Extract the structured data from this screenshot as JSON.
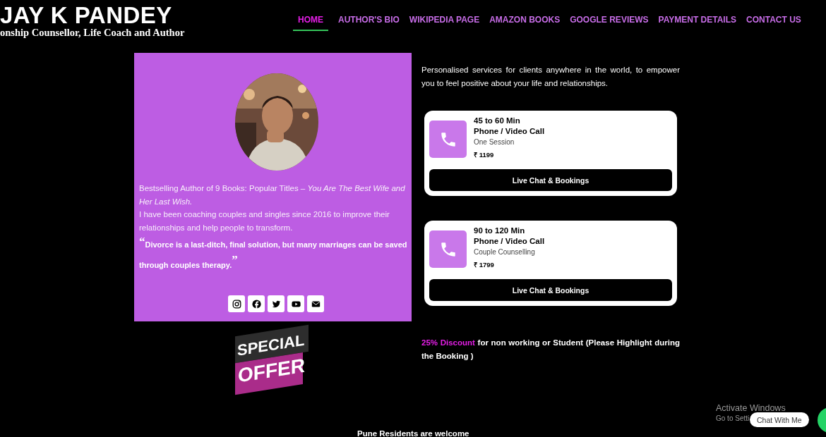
{
  "header": {
    "logo_title": "JAY K PANDEY",
    "logo_subtitle": "onship Counsellor, Life Coach and Author"
  },
  "nav": [
    {
      "label": "HOME",
      "selected": true
    },
    {
      "label": "AUTHOR'S BIO",
      "selected": false
    },
    {
      "label": "WIKIPEDIA PAGE",
      "selected": false
    },
    {
      "label": "AMAZON BOOKS",
      "selected": false
    },
    {
      "label": "GOOGLE REVIEWS",
      "selected": false
    },
    {
      "label": "PAYMENT DETAILS",
      "selected": false
    },
    {
      "label": "CONTACT US",
      "selected": false
    }
  ],
  "profile": {
    "bio": "Bestselling Author of 9 Books: Popular Titles – *You Are The Best Wife and Her Last Wish.*",
    "coaching": "I have been coaching couples and singles since 2016 to improve their relationships and help people to transform.",
    "quote_open": "“",
    "quote": "Divorce is a last-ditch, final solution, but many marriages can be saved through couples therapy.",
    "quote_close": "”",
    "social": [
      {
        "kind": "instagram"
      },
      {
        "kind": "facebook"
      },
      {
        "kind": "twitter"
      },
      {
        "kind": "youtube"
      },
      {
        "kind": "email"
      }
    ]
  },
  "intro": "Personalised services for clients anywhere in the world, to empower you to feel positive about your life and relationships.",
  "services": [
    {
      "duration": "45 to 60 Min",
      "type": "Phone / Video Call",
      "description": "One Session",
      "price": "₹ 1199",
      "button": "Live Chat & Bookings"
    },
    {
      "duration": "90 to 120 Min",
      "type": "Phone / Video Call",
      "description": "Couple Counselling",
      "price": "₹ 1799",
      "button": "Live Chat & Bookings"
    }
  ],
  "offer_badge": {
    "top": "SPECIAL",
    "bottom": "OFFER"
  },
  "discount": "**25% Discount** for non working or Student (Please Highlight during the Booking )",
  "footer_note": "Pune Residents are welcome",
  "os_notice": {
    "title": "Activate Windows",
    "subtitle": "Go to Setti"
  },
  "chat": {
    "label": "Chat With Me"
  }
}
